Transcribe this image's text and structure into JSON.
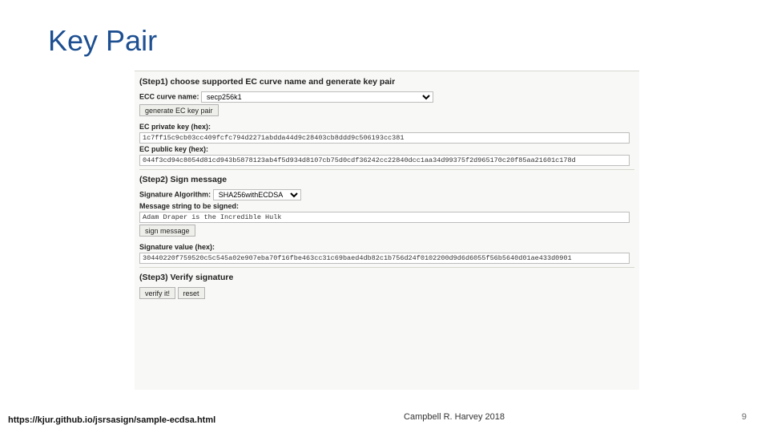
{
  "title": "Key Pair",
  "footer": {
    "url": "https://kjur.github.io/jsrsasign/sample-ecdsa.html",
    "author": "Campbell R. Harvey 2018",
    "page": "9"
  },
  "panel": {
    "step1": {
      "heading": "(Step1) choose supported EC curve name and generate key pair",
      "curve_label": "ECC curve name:",
      "curve_value": "secp256k1",
      "gen_button": "generate EC key pair",
      "priv_label": "EC private key (hex):",
      "priv_value": "1c7ff15c9cb03cc409fcfc794d2271abdda44d9c28403cb8ddd9c506193cc381",
      "pub_label": "EC public key (hex):",
      "pub_value": "044f3cd94c8054d81cd943b5878123ab4f5d934d8107cb75d0cdf36242cc22840dcc1aa34d99375f2d965170c20f85aa21601c178d"
    },
    "step2": {
      "heading": "(Step2) Sign message",
      "alg_label": "Signature Algorithm:",
      "alg_value": "SHA256withECDSA",
      "msg_label": "Message string to be signed:",
      "msg_value": "Adam Draper is the Incredible Hulk",
      "sign_button": "sign message",
      "sig_label": "Signature value (hex):",
      "sig_value": "30440220f759520c5c545a02e907eba70f16fbe463cc31c69baed4db82c1b756d24f0102200d9d6d6055f56b5640d01ae433d0901"
    },
    "step3": {
      "heading": "(Step3) Verify signature",
      "verify_button": "verify it!",
      "reset_button": "reset"
    }
  }
}
